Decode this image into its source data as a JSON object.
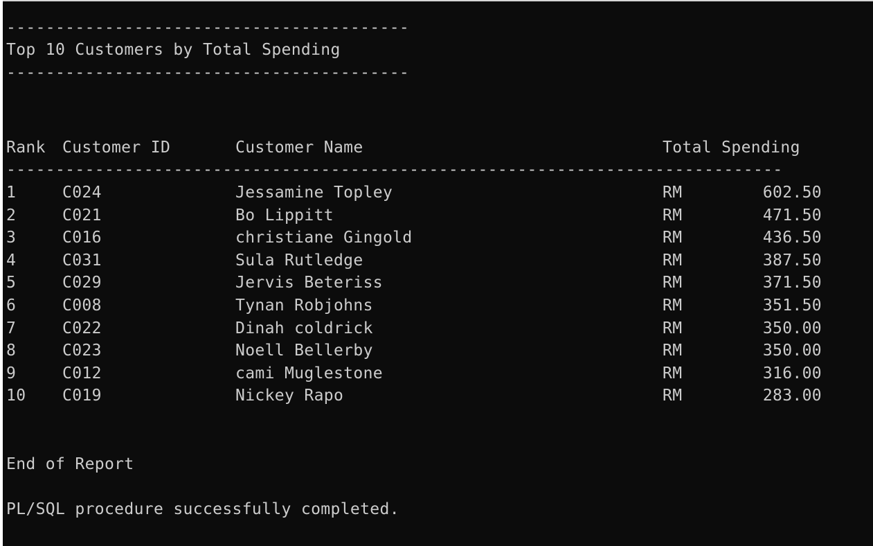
{
  "report": {
    "rule_short": "-----------------------------------------",
    "title": "Top 10 Customers by Total Spending",
    "headers": {
      "rank": "Rank",
      "customer_id": "Customer ID",
      "customer_name": "Customer Name",
      "total_spending": "Total Spending"
    },
    "rule_long": "-------------------------------------------------------------------------------",
    "rows": [
      {
        "rank": "1",
        "id": "C024",
        "name": "Jessamine Topley",
        "currency": "RM",
        "amount": "602.50"
      },
      {
        "rank": "2",
        "id": "C021",
        "name": "Bo Lippitt",
        "currency": "RM",
        "amount": "471.50"
      },
      {
        "rank": "3",
        "id": "C016",
        "name": "christiane Gingold",
        "currency": "RM",
        "amount": "436.50"
      },
      {
        "rank": "4",
        "id": "C031",
        "name": "Sula Rutledge",
        "currency": "RM",
        "amount": "387.50"
      },
      {
        "rank": "5",
        "id": "C029",
        "name": "Jervis Beteriss",
        "currency": "RM",
        "amount": "371.50"
      },
      {
        "rank": "6",
        "id": "C008",
        "name": "Tynan Robjohns",
        "currency": "RM",
        "amount": "351.50"
      },
      {
        "rank": "7",
        "id": "C022",
        "name": "Dinah coldrick",
        "currency": "RM",
        "amount": "350.00"
      },
      {
        "rank": "8",
        "id": "C023",
        "name": "Noell Bellerby",
        "currency": "RM",
        "amount": "350.00"
      },
      {
        "rank": "9",
        "id": "C012",
        "name": "cami Muglestone",
        "currency": "RM",
        "amount": "316.00"
      },
      {
        "rank": "10",
        "id": "C019",
        "name": "Nickey Rapo",
        "currency": "RM",
        "amount": "283.00"
      }
    ],
    "footer": "End of Report",
    "status": "PL/SQL procedure successfully completed."
  },
  "colors": {
    "background": "#0c0c0c",
    "text": "#cccccc"
  }
}
